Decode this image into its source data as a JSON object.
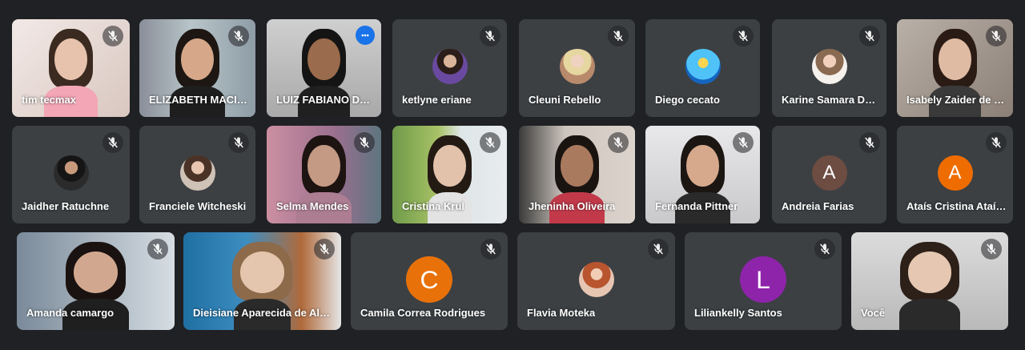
{
  "meeting": {
    "self_label": "Você",
    "participants": [
      {
        "name": "tim tecmax",
        "type": "video",
        "muted": true
      },
      {
        "name": "ELIZABETH MACIEL",
        "type": "video",
        "muted": true
      },
      {
        "name": "LUIZ FABIANO DOS SANTOS",
        "type": "video",
        "muted": false,
        "speaking": true
      },
      {
        "name": "ketlyne eriane",
        "type": "avatar",
        "muted": true
      },
      {
        "name": "Cleuni Rebello",
        "type": "avatar",
        "muted": true
      },
      {
        "name": "Diego cecato",
        "type": "avatar",
        "muted": true
      },
      {
        "name": "Karine Samara De Oliveira",
        "type": "avatar",
        "muted": true
      },
      {
        "name": "Isabely Zaider de Souza",
        "type": "video",
        "muted": true
      },
      {
        "name": "Jaidher Ratuchne",
        "type": "avatar",
        "muted": true
      },
      {
        "name": "Franciele Witcheski",
        "type": "avatar",
        "muted": true
      },
      {
        "name": "Selma Mendes",
        "type": "video",
        "muted": true
      },
      {
        "name": "Cristina Krul",
        "type": "video",
        "muted": true
      },
      {
        "name": "Jheninha Oliveira",
        "type": "video",
        "muted": true
      },
      {
        "name": "Fernanda Pittner",
        "type": "video",
        "muted": true
      },
      {
        "name": "Andreia Farias",
        "type": "letter",
        "letter": "A",
        "color": "#6d4c41",
        "muted": true
      },
      {
        "name": "Ataís Cristina Ataíde",
        "type": "letter",
        "letter": "A",
        "color": "#ef6c00",
        "muted": true
      },
      {
        "name": "Amanda camargo",
        "type": "video",
        "muted": true
      },
      {
        "name": "Dieisiane Aparecida de Almeida",
        "type": "video",
        "muted": true
      },
      {
        "name": "Camila Correa Rodrigues",
        "type": "letter",
        "letter": "C",
        "color": "#e8710a",
        "muted": true
      },
      {
        "name": "Flavia Moteka",
        "type": "avatar",
        "muted": true
      },
      {
        "name": "Liliankelly Santos",
        "type": "letter",
        "letter": "L",
        "color": "#8e24aa",
        "muted": true
      },
      {
        "name": "Você",
        "type": "video",
        "muted": true
      }
    ]
  },
  "colors": {
    "background": "#202124",
    "tile": "#3c4043",
    "speaking_outline": "#8ab4f8",
    "more_button": "#1a73e8"
  }
}
